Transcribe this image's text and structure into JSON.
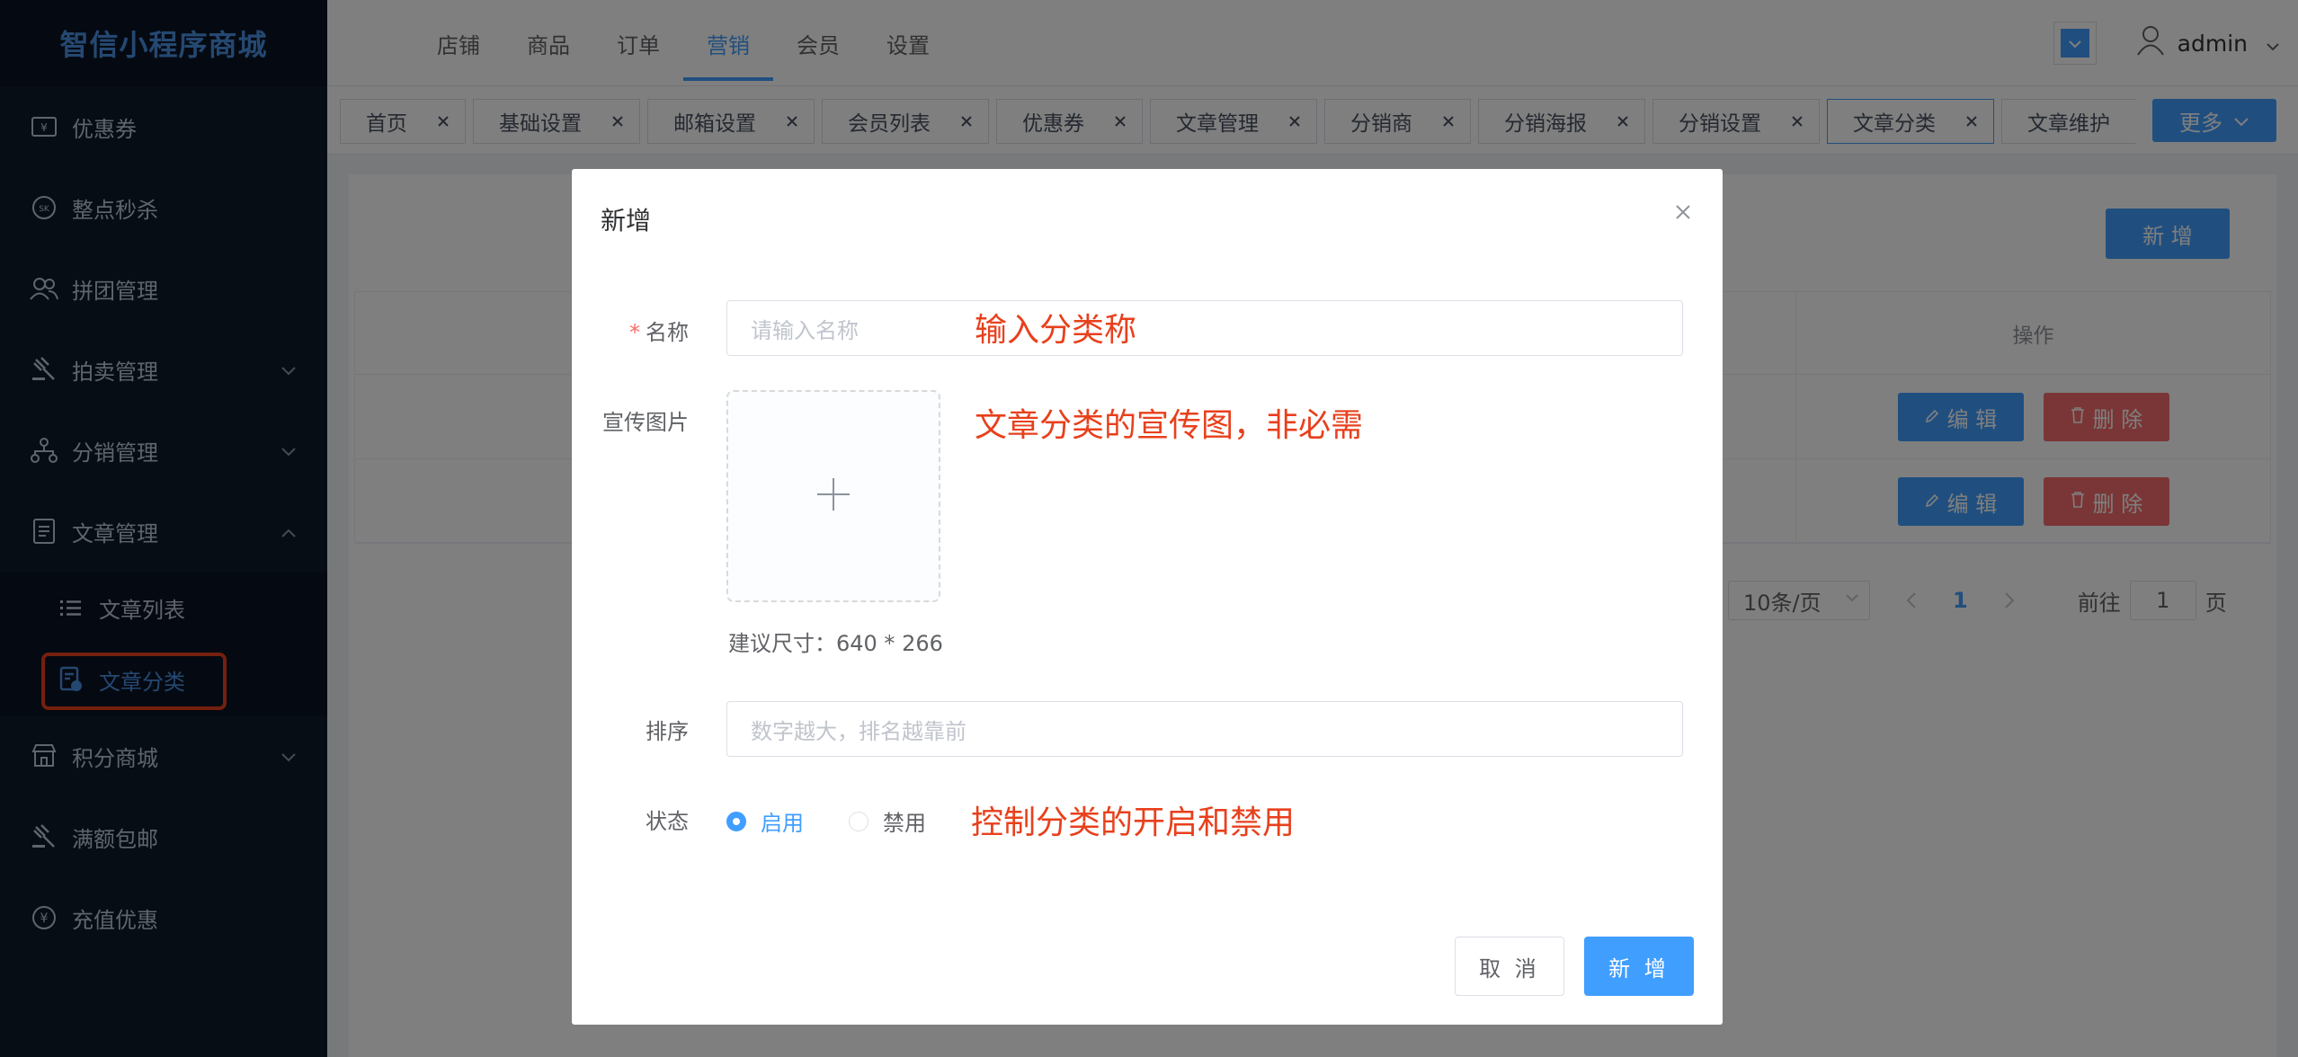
{
  "sidebar": {
    "logo": "智信小程序商城",
    "items": [
      {
        "label": "优惠券",
        "icon": "coupon-icon"
      },
      {
        "label": "整点秒杀",
        "icon": "flash-sale-icon"
      },
      {
        "label": "拼团管理",
        "icon": "group-buy-icon"
      },
      {
        "label": "拍卖管理",
        "icon": "auction-icon"
      },
      {
        "label": "分销管理",
        "icon": "distribution-icon"
      },
      {
        "label": "文章管理",
        "icon": "article-icon"
      },
      {
        "label": "积分商城",
        "icon": "points-mall-icon"
      },
      {
        "label": "满额包邮",
        "icon": "free-shipping-icon"
      },
      {
        "label": "充值优惠",
        "icon": "recharge-icon"
      }
    ],
    "sub_items": [
      {
        "label": "文章列表",
        "icon": "list-icon"
      },
      {
        "label": "文章分类",
        "icon": "category-icon"
      }
    ]
  },
  "topnav": {
    "items": [
      "店铺",
      "商品",
      "订单",
      "营销",
      "会员",
      "设置"
    ],
    "active": "营销",
    "user": "admin"
  },
  "tags": {
    "items": [
      "首页",
      "基础设置",
      "邮箱设置",
      "会员列表",
      "优惠券",
      "文章管理",
      "分销商",
      "分销海报",
      "分销设置",
      "文章分类",
      "文章维护"
    ],
    "active": "文章分类",
    "more": "更多"
  },
  "content": {
    "add_button": "新 增",
    "table_header_op": "操作",
    "edit_label": "编 辑",
    "delete_label": "删 除",
    "pager": {
      "page_size": "10条/页",
      "current": "1",
      "goto_prefix": "前往",
      "goto_value": "1",
      "goto_suffix": "页"
    }
  },
  "dialog": {
    "title": "新增",
    "name_label": "名称",
    "name_placeholder": "请输入名称",
    "image_label": "宣传图片",
    "size_hint": "建议尺寸：640 * 266",
    "sort_label": "排序",
    "sort_placeholder": "数字越大，排名越靠前",
    "status_label": "状态",
    "status_options": [
      "启用",
      "禁用"
    ],
    "status_selected": "启用",
    "cancel": "取 消",
    "submit": "新 增"
  },
  "annotations": {
    "name": "输入分类称",
    "image": "文章分类的宣传图，非必需",
    "status": "控制分类的开启和禁用",
    "color": "#e8401c"
  }
}
